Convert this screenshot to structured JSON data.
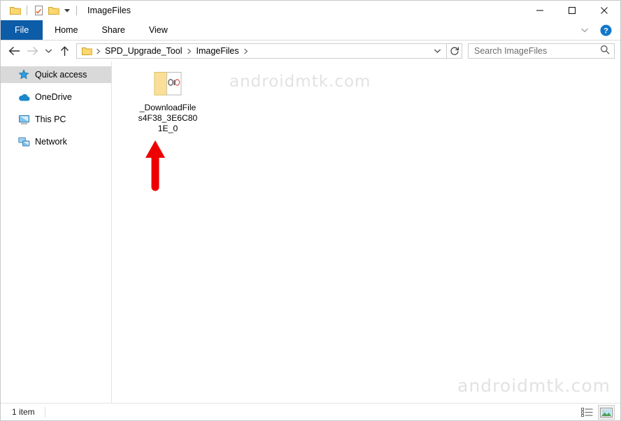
{
  "window": {
    "title": "ImageFiles",
    "quick_access_toolbar": [
      {
        "name": "folder-icon",
        "label": "Folder"
      },
      {
        "name": "properties-icon",
        "label": "Properties"
      },
      {
        "name": "new-folder-icon",
        "label": "New folder"
      },
      {
        "name": "chevron-down-icon",
        "label": "Customize Quick Access Toolbar"
      }
    ],
    "controls": {
      "minimize": "—",
      "maximize": "□",
      "close": "✕"
    }
  },
  "ribbon": {
    "tabs": [
      {
        "label": "File",
        "selected": true
      },
      {
        "label": "Home",
        "selected": false
      },
      {
        "label": "Share",
        "selected": false
      },
      {
        "label": "View",
        "selected": false
      }
    ],
    "collapse_icon": "chevron-down-icon",
    "help_icon": "help-icon",
    "file_tab_color": "#0d5ca8"
  },
  "navbar": {
    "back": "back-arrow-icon",
    "forward": "forward-arrow-icon",
    "recent": "chevron-down-icon",
    "up": "up-arrow-icon",
    "breadcrumbs": [
      {
        "label": "SPD_Upgrade_Tool"
      },
      {
        "label": "ImageFiles"
      }
    ],
    "refresh": "refresh-icon"
  },
  "search": {
    "placeholder": "Search ImageFiles",
    "icon": "search-icon"
  },
  "sidebar": {
    "items": [
      {
        "label": "Quick access",
        "icon": "star-icon",
        "selected": true
      },
      {
        "label": "OneDrive",
        "icon": "cloud-icon",
        "selected": false
      },
      {
        "label": "This PC",
        "icon": "monitor-icon",
        "selected": false
      },
      {
        "label": "Network",
        "icon": "network-icon",
        "selected": false
      }
    ]
  },
  "files": {
    "items": [
      {
        "name": "_DownloadFiles4F38_3E6C801E_0",
        "icon": "open-folder-icon",
        "type": "folder"
      }
    ]
  },
  "annotation": {
    "arrow": {
      "name": "red-up-arrow-annotation",
      "color": "#ee0000",
      "direction": "up"
    }
  },
  "watermarks": {
    "top": "androidmtk.com",
    "bottom": "androidmtk.com",
    "color": "#e2e2e2"
  },
  "statusbar": {
    "item_count": "1 item",
    "views": [
      {
        "name": "details-view-icon",
        "active": false
      },
      {
        "name": "large-icons-view-icon",
        "active": true
      }
    ]
  }
}
